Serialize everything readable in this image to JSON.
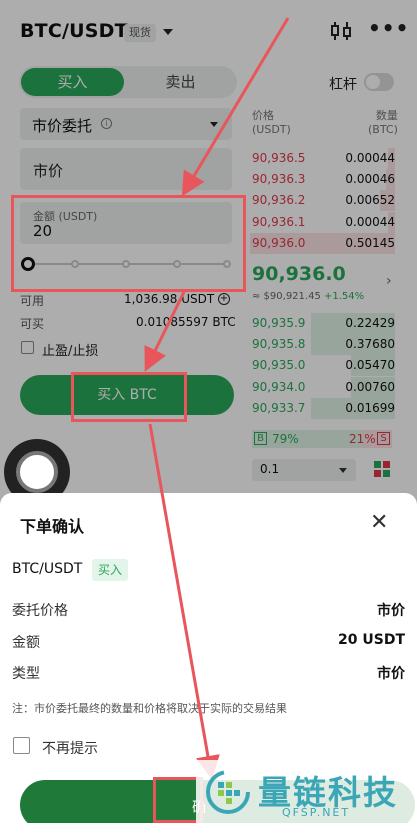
{
  "header": {
    "pair": "BTC/USDT",
    "spot_tag": "现货",
    "chart_icon": "candlestick-icon",
    "more_icon": "more-icon"
  },
  "trade_panel": {
    "tabs": {
      "buy": "买入",
      "sell": "卖出"
    },
    "leverage_label": "杠杆",
    "order_type": "市价委托",
    "market_price_field": "市价",
    "amount_placeholder": "金额 (USDT)",
    "amount_value": "20",
    "slider_percent": 0,
    "available_label": "可用",
    "available_value": "1,036.98 USDT",
    "can_buy_label": "可买",
    "can_buy_value": "0.01085597 BTC",
    "tpsl_label": "止盈/止损",
    "buy_button": "买入 BTC"
  },
  "order_book": {
    "price_header": "价格",
    "price_unit": "(USDT)",
    "qty_header": "数量",
    "qty_unit": "(BTC)",
    "asks": [
      {
        "price": "90,936.5",
        "qty": "0.00044",
        "depth": 0.05
      },
      {
        "price": "90,936.3",
        "qty": "0.00046",
        "depth": 0.06
      },
      {
        "price": "90,936.2",
        "qty": "0.00652",
        "depth": 0.1
      },
      {
        "price": "90,936.1",
        "qty": "0.00044",
        "depth": 0.05
      },
      {
        "price": "90,936.0",
        "qty": "0.50145",
        "depth": 1.0
      }
    ],
    "last_price": "90,936.0",
    "last_sub": "≈ $90,921.45",
    "last_change": "+1.54%",
    "bids": [
      {
        "price": "90,935.9",
        "qty": "0.22429",
        "depth": 0.58
      },
      {
        "price": "90,935.8",
        "qty": "0.37680",
        "depth": 0.58
      },
      {
        "price": "90,935.0",
        "qty": "0.05470",
        "depth": 0.3
      },
      {
        "price": "90,934.0",
        "qty": "0.00760",
        "depth": 0.3
      },
      {
        "price": "90,933.7",
        "qty": "0.01699",
        "depth": 0.58
      }
    ],
    "buy_ratio_label": "B",
    "buy_ratio": "79%",
    "sell_ratio": "21%",
    "sell_ratio_label": "S",
    "buy_ratio_value": 0.79,
    "depth_value": "0.1"
  },
  "confirm_sheet": {
    "title": "下单确认",
    "pair": "BTC/USDT",
    "side_badge": "买入",
    "rows": [
      {
        "label": "委托价格",
        "value": "市价"
      },
      {
        "label": "金额",
        "value": "20 USDT"
      },
      {
        "label": "类型",
        "value": "市价"
      }
    ],
    "note": "注：市价委托最终的数量和价格将取决于实际的交易结果",
    "dont_remind": "不再提示",
    "confirm_button": "确"
  },
  "watermark": {
    "text": "量链科技",
    "sub": "QFSP.NET"
  },
  "colors": {
    "green": "#2aa85a",
    "red": "#e0394a",
    "annotation": "#e8555a"
  }
}
